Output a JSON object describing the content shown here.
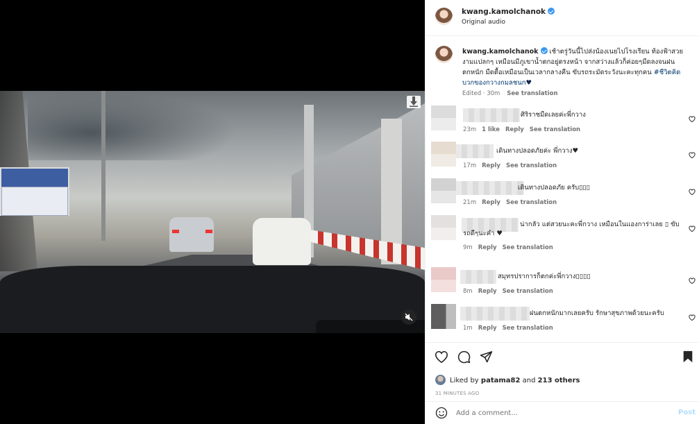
{
  "header": {
    "username": "kwang.kamolchanok",
    "audio": "Original audio"
  },
  "caption": {
    "username": "kwang.kamolchanok",
    "text": "เช้าตรู่วันนี้ไปส่งน้องเนยไปโรงเรียน ท้องฟ้าสวยงามแปลกๆ เหมือนมีภูเขาน้ำตกอยู่ตรงหน้า จากสว่างแล้วก็ค่อยๆมืดลงจนฝนตกหนัก มืดตื้อเหมือนเป็นเวลากลางคืน ขับรถระมัดระวังนะคะทุกคน",
    "hashtag": "#ชีวิตคิดบวกของกวางกมลชนก",
    "heart": "♥",
    "edited": "Edited · 30m",
    "see_translation": "See translation"
  },
  "comments": [
    {
      "text": "ศิริราชมืดเลยค่ะพี่กวาง",
      "time": "23m",
      "likes": "1 like",
      "reply": "Reply",
      "see_translation": "See translation"
    },
    {
      "text": "เดินทางปลอดภัยค่ะ พี่กวาง♥",
      "time": "17m",
      "likes": "",
      "reply": "Reply",
      "see_translation": "See translation"
    },
    {
      "text": "เดินทางปลอดภัย ครับ▯▯▯",
      "time": "21m",
      "likes": "",
      "reply": "Reply",
      "see_translation": "See translation"
    },
    {
      "text": "น่ากลัว แต่สวยนะคะพี่กวาง เหมือนในแองการ่าเลย ▯ ขับรถดีๆนะคํา ♥",
      "time": "9m",
      "likes": "",
      "reply": "Reply",
      "see_translation": "See translation"
    },
    {
      "text": "สมุทรปราการก็ตกค่ะพี่กวาง▯▯▯▯",
      "time": "8m",
      "likes": "",
      "reply": "Reply",
      "see_translation": "See translation"
    },
    {
      "text": "ฝนตกหนักมากเลยครับ รักษาสุขภาพด้วยนะครับ",
      "time": "1m",
      "likes": "",
      "reply": "Reply",
      "see_translation": "See translation"
    }
  ],
  "likes": {
    "prefix": "Liked by",
    "user": "patama82",
    "and": "and",
    "others": "213 others"
  },
  "time_ago": "31 MINUTES AGO",
  "comment_box": {
    "placeholder": "Add a comment...",
    "post": "Post"
  },
  "colors": {
    "verified": "#3897f0",
    "link": "#00376b",
    "post_disabled": "#b2dffc",
    "meta": "#737373"
  },
  "icons": {
    "download": "download-icon",
    "mute": "muted-speaker-icon",
    "like": "heart-outline-icon",
    "comment": "comment-bubble-icon",
    "share": "paper-plane-icon",
    "save": "bookmark-filled-icon",
    "emoji": "emoji-icon",
    "comment_like": "heart-small-icon"
  }
}
